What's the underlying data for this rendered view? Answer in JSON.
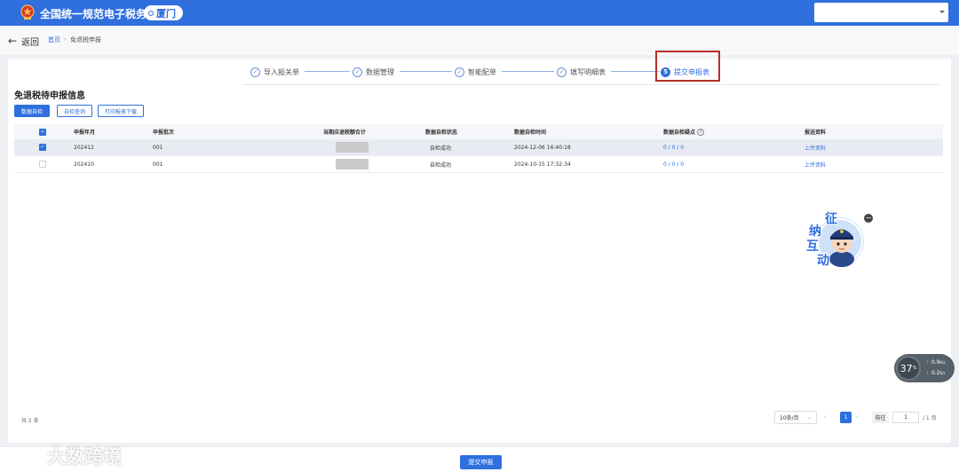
{
  "header": {
    "title": "全国统一规范电子税务局",
    "region": "厦门",
    "user_name": ""
  },
  "breadcrumb": {
    "back_label": "返回",
    "home": "首页",
    "separator": "›",
    "current": "免退税申报"
  },
  "steps": [
    {
      "label": "导入报关单",
      "icon": "check-circle-icon",
      "status": "done"
    },
    {
      "label": "数据管理",
      "icon": "check-circle-icon",
      "status": "done"
    },
    {
      "label": "智能配单",
      "icon": "check-circle-icon",
      "status": "done"
    },
    {
      "label": "填写明细表",
      "icon": "check-circle-icon",
      "status": "done"
    },
    {
      "label": "提交申报表",
      "number": "5",
      "status": "current"
    }
  ],
  "section_title": "免退税待申报信息",
  "buttons": {
    "self_check": "数据自检",
    "self_check_query": "自检查询",
    "print_download": "打印报表下载"
  },
  "table": {
    "columns": [
      "申报年月",
      "申报批次",
      "当期应退税额合计",
      "数据自检状态",
      "数据自检时间",
      "数据自检疑点",
      "报送资料"
    ],
    "rows": [
      {
        "selected": true,
        "period": "202412",
        "batch": "001",
        "amount": "",
        "status": "自检成功",
        "time": "2024-12-06 16:40:18",
        "doubts": "0 / 0 / 0",
        "materials": "上传资料"
      },
      {
        "selected": false,
        "period": "202410",
        "batch": "001",
        "amount": "",
        "status": "自检成功",
        "time": "2024-10-15 17:32:34",
        "doubts": "0 / 0 / 0",
        "materials": "上传资料"
      }
    ]
  },
  "pagination": {
    "total": "共 2 条",
    "page_size": "10条/页",
    "current_page": "1",
    "goto_label": "前往",
    "goto_value": "1",
    "total_pages": "/ 1 页"
  },
  "submit_label": "提交申报",
  "assistant": {
    "chars": [
      "征",
      "纳",
      "互",
      "动"
    ],
    "close": "−"
  },
  "speed_widget": {
    "value": "37",
    "unit": "%",
    "up": "0.9",
    "down": "0.2",
    "rate_unit": "K/s"
  },
  "watermark": "大数跨境",
  "colors": {
    "primary": "#2f6fde",
    "highlight_border": "#b62f2a"
  }
}
